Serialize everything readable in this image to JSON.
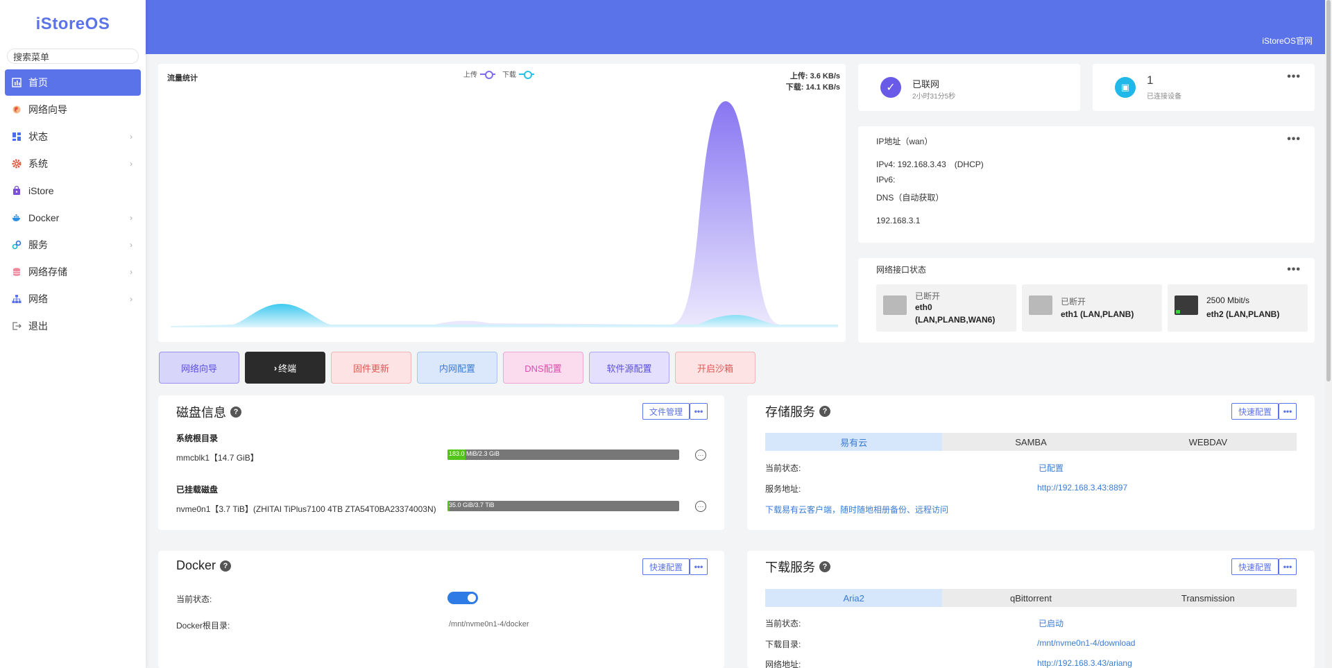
{
  "app": {
    "logo": "iStoreOS",
    "search_placeholder": "搜索菜单",
    "official_link": "iStoreOS官网"
  },
  "sidebar": {
    "items": [
      {
        "label": "首页",
        "icon": "dashboard-icon",
        "active": true
      },
      {
        "label": "网络向导",
        "icon": "globe-icon"
      },
      {
        "label": "状态",
        "icon": "grid-icon",
        "chevron": true
      },
      {
        "label": "系统",
        "icon": "gear-icon",
        "chevron": true
      },
      {
        "label": "iStore",
        "icon": "bag-icon"
      },
      {
        "label": "Docker",
        "icon": "docker-icon",
        "chevron": true
      },
      {
        "label": "服务",
        "icon": "link-icon",
        "chevron": true
      },
      {
        "label": "网络存储",
        "icon": "database-icon",
        "chevron": true
      },
      {
        "label": "网络",
        "icon": "network-icon",
        "chevron": true
      },
      {
        "label": "退出",
        "icon": "logout-icon"
      }
    ]
  },
  "traffic": {
    "title": "流量统计",
    "legend_up": "上传",
    "legend_down": "下载",
    "upload_speed": "上传: 3.6 KB/s",
    "download_speed": "下载: 14.1 KB/s",
    "colors": {
      "upload": "#7b6cf0",
      "download": "#25c2e8"
    }
  },
  "connection": {
    "status": "已联网",
    "duration": "2小时31分5秒"
  },
  "devices": {
    "count": "1",
    "label": "已连接设备"
  },
  "ip": {
    "title": "IP地址（wan）",
    "ipv4": "IPv4: 192.168.3.43　(DHCP)",
    "ipv6": "IPv6:",
    "dns_title": "DNS（自动获取）",
    "dns": "192.168.3.1"
  },
  "interfaces": {
    "title": "网络接口状态",
    "items": [
      {
        "state": "已断开",
        "name": "eth0",
        "extra": "(LAN,PLANB,WAN6)",
        "connected": false
      },
      {
        "state": "已断开",
        "name": "eth1 (LAN,PLANB)",
        "connected": false
      },
      {
        "state": "2500 Mbit/s",
        "name": "eth2 (LAN,PLANB)",
        "connected": true
      }
    ]
  },
  "actions": [
    {
      "label": "网络向导",
      "bg": "#d8d5fb",
      "border": "#9b91f0",
      "color": "#5b4fe0"
    },
    {
      "label": "终端",
      "prefix": "›",
      "bg": "#2b2b2b",
      "border": "#2b2b2b",
      "color": "#ffffff"
    },
    {
      "label": "固件更新",
      "bg": "#fde3e3",
      "border": "#f3b5b5",
      "color": "#e25757"
    },
    {
      "label": "内网配置",
      "bg": "#dbe8fb",
      "border": "#a8c6f2",
      "color": "#3a7bd5"
    },
    {
      "label": "DNS配置",
      "bg": "#fbdcef",
      "border": "#f0a6d6",
      "color": "#e04bb0"
    },
    {
      "label": "软件源配置",
      "bg": "#e4dffc",
      "border": "#b0a5f2",
      "color": "#5b4fe0"
    },
    {
      "label": "开启沙箱",
      "bg": "#fde3e3",
      "border": "#f3b5b5",
      "color": "#e25757"
    }
  ],
  "disk": {
    "title": "磁盘信息",
    "file_manage": "文件管理",
    "root_title": "系统根目录",
    "root_name": "mmcblk1【14.7 GiB】",
    "root_usage": "183.0 MiB/2.3 GiB",
    "root_fraction": 0.078,
    "mounted_title": "已挂载磁盘",
    "mounted_name": "nvme0n1【3.7 TiB】(ZHITAI TiPlus7100 4TB ZTA54T0BA23374003N)",
    "mounted_usage": "35.0 GiB/3.7 TiB",
    "mounted_fraction": 0.009
  },
  "storage": {
    "title": "存储服务",
    "quick": "快速配置",
    "tabs": [
      "易有云",
      "SAMBA",
      "WEBDAV"
    ],
    "status_label": "当前状态:",
    "status_value": "已配置",
    "addr_label": "服务地址:",
    "addr_value": "http://192.168.3.43:8897",
    "download_link": "下载易有云客户端，随时随地相册备份、远程访问"
  },
  "docker": {
    "title": "Docker",
    "quick": "快速配置",
    "status_label": "当前状态:",
    "enabled": true,
    "root_label": "Docker根目录:",
    "root_value": "/mnt/nvme0n1-4/docker"
  },
  "download": {
    "title": "下载服务",
    "quick": "快速配置",
    "tabs": [
      "Aria2",
      "qBittorrent",
      "Transmission"
    ],
    "status_label": "当前状态:",
    "status_value": "已启动",
    "dir_label": "下载目录:",
    "dir_value": "/mnt/nvme0n1-4/download",
    "net_label": "网络地址:",
    "net_value": "http://192.168.3.43/ariang"
  },
  "more_label": "•••",
  "help_label": "?"
}
